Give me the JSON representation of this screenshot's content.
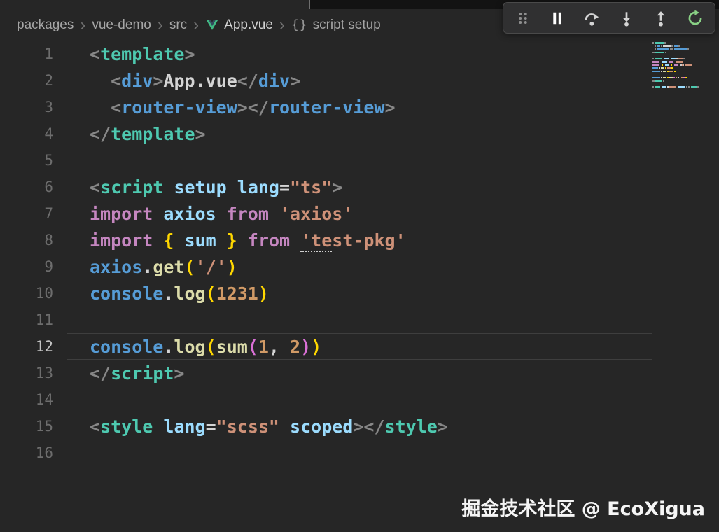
{
  "colors": {
    "editor_background": "#262626",
    "toolbar_background": "#303031",
    "restart_green": "#89D185",
    "vue_green": "#41B883",
    "vue_dark": "#35495E",
    "active_line_border": "#3e3e3e"
  },
  "breadcrumb": {
    "separator_glyph": "›",
    "braces_glyph": "{}",
    "items": [
      {
        "label": "packages"
      },
      {
        "label": "vue-demo"
      },
      {
        "label": "src"
      },
      {
        "label": "App.vue",
        "icon": "vue-logo-icon"
      },
      {
        "label": "script setup",
        "icon": "symbol-braces-icon"
      }
    ]
  },
  "debug_toolbar": {
    "buttons": [
      {
        "name": "drag-handle",
        "icon": "gripper-icon"
      },
      {
        "name": "pause",
        "icon": "pause-icon"
      },
      {
        "name": "step-over",
        "icon": "step-over-icon"
      },
      {
        "name": "step-into",
        "icon": "step-into-icon"
      },
      {
        "name": "step-out",
        "icon": "step-out-icon"
      },
      {
        "name": "restart",
        "icon": "restart-icon"
      }
    ]
  },
  "editor": {
    "active_line": 12,
    "lines": [
      {
        "n": 1,
        "tokens": [
          [
            "<",
            "p"
          ],
          [
            "template",
            "tagv"
          ],
          [
            ">",
            "p"
          ]
        ]
      },
      {
        "n": 2,
        "tokens": [
          [
            "  ",
            "tx"
          ],
          [
            "<",
            "p"
          ],
          [
            "div",
            "tag"
          ],
          [
            ">",
            "p"
          ],
          [
            "App.vue",
            "tx"
          ],
          [
            "</",
            "p"
          ],
          [
            "div",
            "tag"
          ],
          [
            ">",
            "p"
          ]
        ]
      },
      {
        "n": 3,
        "tokens": [
          [
            "  ",
            "tx"
          ],
          [
            "<",
            "p"
          ],
          [
            "router-view",
            "tag"
          ],
          [
            "></",
            "p"
          ],
          [
            "router-view",
            "tag"
          ],
          [
            ">",
            "p"
          ]
        ]
      },
      {
        "n": 4,
        "tokens": [
          [
            "</",
            "p"
          ],
          [
            "template",
            "tagv"
          ],
          [
            ">",
            "p"
          ]
        ]
      },
      {
        "n": 5,
        "tokens": []
      },
      {
        "n": 6,
        "tokens": [
          [
            "<",
            "p"
          ],
          [
            "script",
            "tagv"
          ],
          [
            " ",
            "tx"
          ],
          [
            "setup",
            "attr"
          ],
          [
            " ",
            "tx"
          ],
          [
            "lang",
            "attr"
          ],
          [
            "=",
            "tx"
          ],
          [
            "\"ts\"",
            "str"
          ],
          [
            ">",
            "p"
          ]
        ]
      },
      {
        "n": 7,
        "tokens": [
          [
            "import",
            "kw"
          ],
          [
            " ",
            "tx"
          ],
          [
            "axios",
            "var"
          ],
          [
            " ",
            "tx"
          ],
          [
            "from",
            "kw"
          ],
          [
            " ",
            "tx"
          ],
          [
            "'axios'",
            "str"
          ]
        ]
      },
      {
        "n": 8,
        "tokens": [
          [
            "import",
            "kw"
          ],
          [
            " ",
            "tx"
          ],
          [
            "{",
            "b1"
          ],
          [
            " ",
            "tx"
          ],
          [
            "sum",
            "var"
          ],
          [
            " ",
            "tx"
          ],
          [
            "}",
            "b1"
          ],
          [
            " ",
            "tx"
          ],
          [
            "from",
            "kw"
          ],
          [
            " ",
            "tx"
          ],
          [
            "'te",
            "str und"
          ],
          [
            "st-pkg'",
            "str"
          ]
        ]
      },
      {
        "n": 9,
        "tokens": [
          [
            "axios",
            "obj"
          ],
          [
            ".",
            "tx"
          ],
          [
            "get",
            "fn"
          ],
          [
            "(",
            "b1"
          ],
          [
            "'/'",
            "str"
          ],
          [
            ")",
            "b1"
          ]
        ]
      },
      {
        "n": 10,
        "tokens": [
          [
            "console",
            "obj"
          ],
          [
            ".",
            "tx"
          ],
          [
            "log",
            "fn"
          ],
          [
            "(",
            "b1"
          ],
          [
            "1231",
            "num"
          ],
          [
            ")",
            "b1"
          ]
        ]
      },
      {
        "n": 11,
        "tokens": []
      },
      {
        "n": 12,
        "tokens": [
          [
            "console",
            "obj"
          ],
          [
            ".",
            "tx"
          ],
          [
            "log",
            "fn"
          ],
          [
            "(",
            "b1"
          ],
          [
            "sum",
            "fn"
          ],
          [
            "(",
            "b2"
          ],
          [
            "1",
            "num"
          ],
          [
            ",",
            "tx"
          ],
          [
            " ",
            "tx"
          ],
          [
            "2",
            "num"
          ],
          [
            ")",
            "b2"
          ],
          [
            ")",
            "b1"
          ]
        ]
      },
      {
        "n": 13,
        "tokens": [
          [
            "</",
            "p"
          ],
          [
            "script",
            "tagv"
          ],
          [
            ">",
            "p"
          ]
        ]
      },
      {
        "n": 14,
        "tokens": []
      },
      {
        "n": 15,
        "tokens": [
          [
            "<",
            "p"
          ],
          [
            "style",
            "tagv"
          ],
          [
            " ",
            "tx"
          ],
          [
            "lang",
            "attr"
          ],
          [
            "=",
            "tx"
          ],
          [
            "\"scss\"",
            "str"
          ],
          [
            " ",
            "tx"
          ],
          [
            "scoped",
            "attr"
          ],
          [
            ">",
            "p"
          ],
          [
            "</",
            "p"
          ],
          [
            "style",
            "tagv"
          ],
          [
            ">",
            "p"
          ]
        ]
      },
      {
        "n": 16,
        "tokens": []
      }
    ]
  },
  "watermark": "掘金技术社区 @ EcoXigua"
}
